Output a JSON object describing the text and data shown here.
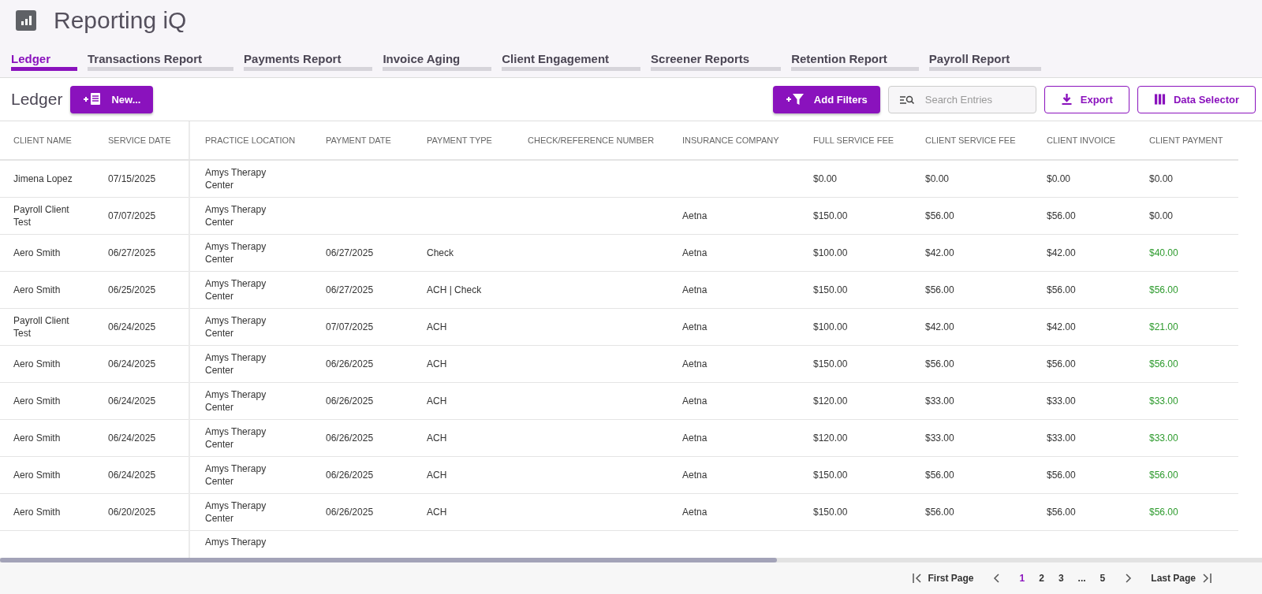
{
  "app": {
    "title": "Reporting iQ"
  },
  "tabs": [
    {
      "label": "Ledger",
      "selected": true
    },
    {
      "label": "Transactions Report",
      "selected": false
    },
    {
      "label": "Payments Report",
      "selected": false
    },
    {
      "label": "Invoice Aging",
      "selected": false
    },
    {
      "label": "Client Engagement",
      "selected": false
    },
    {
      "label": "Screener Reports",
      "selected": false
    },
    {
      "label": "Retention Report",
      "selected": false
    },
    {
      "label": "Payroll Report",
      "selected": false
    }
  ],
  "toolbar": {
    "heading": "Ledger",
    "new_button": "New...",
    "filter_button": "Add Filters",
    "search": {
      "placeholder": "Search Entries"
    },
    "export_button": "Export",
    "data_selector_button": "Data Selector"
  },
  "table": {
    "columns": [
      "CLIENT NAME",
      "SERVICE DATE",
      "PRACTICE LOCATION",
      "PAYMENT DATE",
      "PAYMENT TYPE",
      "CHECK/REFERENCE NUMBER",
      "INSURANCE COMPANY",
      "FULL SERVICE FEE",
      "CLIENT SERVICE FEE",
      "CLIENT INVOICE",
      "CLIENT PAYMENT"
    ],
    "rows": [
      {
        "client_name": "Jimena Lopez",
        "service_date": "07/15/2025",
        "practice_location": "Amys Therapy Center",
        "full_service_fee": "$0.00",
        "client_service_fee": "$0.00",
        "client_invoice": "$0.00",
        "client_payment": "$0.00",
        "paid": false
      },
      {
        "client_name": "Payroll Client Test",
        "service_date": "07/07/2025",
        "practice_location": "Amys Therapy Center",
        "insurance_company": "Aetna",
        "full_service_fee": "$150.00",
        "client_service_fee": "$56.00",
        "client_invoice": "$56.00",
        "client_payment": "$0.00",
        "paid": false
      },
      {
        "client_name": "Aero Smith",
        "service_date": "06/27/2025",
        "practice_location": "Amys Therapy Center",
        "payment_date": "06/27/2025",
        "payment_type": "Check",
        "insurance_company": "Aetna",
        "full_service_fee": "$100.00",
        "client_service_fee": "$42.00",
        "client_invoice": "$42.00",
        "client_payment": "$40.00",
        "paid": true
      },
      {
        "client_name": "Aero Smith",
        "service_date": "06/25/2025",
        "practice_location": "Amys Therapy Center",
        "payment_date": "06/27/2025",
        "payment_type": "ACH | Check",
        "insurance_company": "Aetna",
        "full_service_fee": "$150.00",
        "client_service_fee": "$56.00",
        "client_invoice": "$56.00",
        "client_payment": "$56.00",
        "paid": true
      },
      {
        "client_name": "Payroll Client Test",
        "service_date": "06/24/2025",
        "practice_location": "Amys Therapy Center",
        "payment_date": "07/07/2025",
        "payment_type": "ACH",
        "insurance_company": "Aetna",
        "full_service_fee": "$100.00",
        "client_service_fee": "$42.00",
        "client_invoice": "$42.00",
        "client_payment": "$21.00",
        "paid": true
      },
      {
        "client_name": "Aero Smith",
        "service_date": "06/24/2025",
        "practice_location": "Amys Therapy Center",
        "payment_date": "06/26/2025",
        "payment_type": "ACH",
        "insurance_company": "Aetna",
        "full_service_fee": "$150.00",
        "client_service_fee": "$56.00",
        "client_invoice": "$56.00",
        "client_payment": "$56.00",
        "paid": true
      },
      {
        "client_name": "Aero Smith",
        "service_date": "06/24/2025",
        "practice_location": "Amys Therapy Center",
        "payment_date": "06/26/2025",
        "payment_type": "ACH",
        "insurance_company": "Aetna",
        "full_service_fee": "$120.00",
        "client_service_fee": "$33.00",
        "client_invoice": "$33.00",
        "client_payment": "$33.00",
        "paid": true
      },
      {
        "client_name": "Aero Smith",
        "service_date": "06/24/2025",
        "practice_location": "Amys Therapy Center",
        "payment_date": "06/26/2025",
        "payment_type": "ACH",
        "insurance_company": "Aetna",
        "full_service_fee": "$120.00",
        "client_service_fee": "$33.00",
        "client_invoice": "$33.00",
        "client_payment": "$33.00",
        "paid": true
      },
      {
        "client_name": "Aero Smith",
        "service_date": "06/24/2025",
        "practice_location": "Amys Therapy Center",
        "payment_date": "06/26/2025",
        "payment_type": "ACH",
        "insurance_company": "Aetna",
        "full_service_fee": "$150.00",
        "client_service_fee": "$56.00",
        "client_invoice": "$56.00",
        "client_payment": "$56.00",
        "paid": true
      },
      {
        "client_name": "Aero Smith",
        "service_date": "06/20/2025",
        "practice_location": "Amys Therapy Center",
        "payment_date": "06/26/2025",
        "payment_type": "ACH",
        "insurance_company": "Aetna",
        "full_service_fee": "$150.00",
        "client_service_fee": "$56.00",
        "client_invoice": "$56.00",
        "client_payment": "$56.00",
        "paid": true
      },
      {
        "practice_location": "Amys Therapy"
      }
    ]
  },
  "pagination": {
    "first": "First Page",
    "pages": [
      {
        "label": "1",
        "selected": true
      },
      {
        "label": "2",
        "selected": false
      },
      {
        "label": "3",
        "selected": false
      },
      {
        "label": "...",
        "selected": false
      },
      {
        "label": "5",
        "selected": false
      }
    ],
    "last": "Last Page"
  }
}
